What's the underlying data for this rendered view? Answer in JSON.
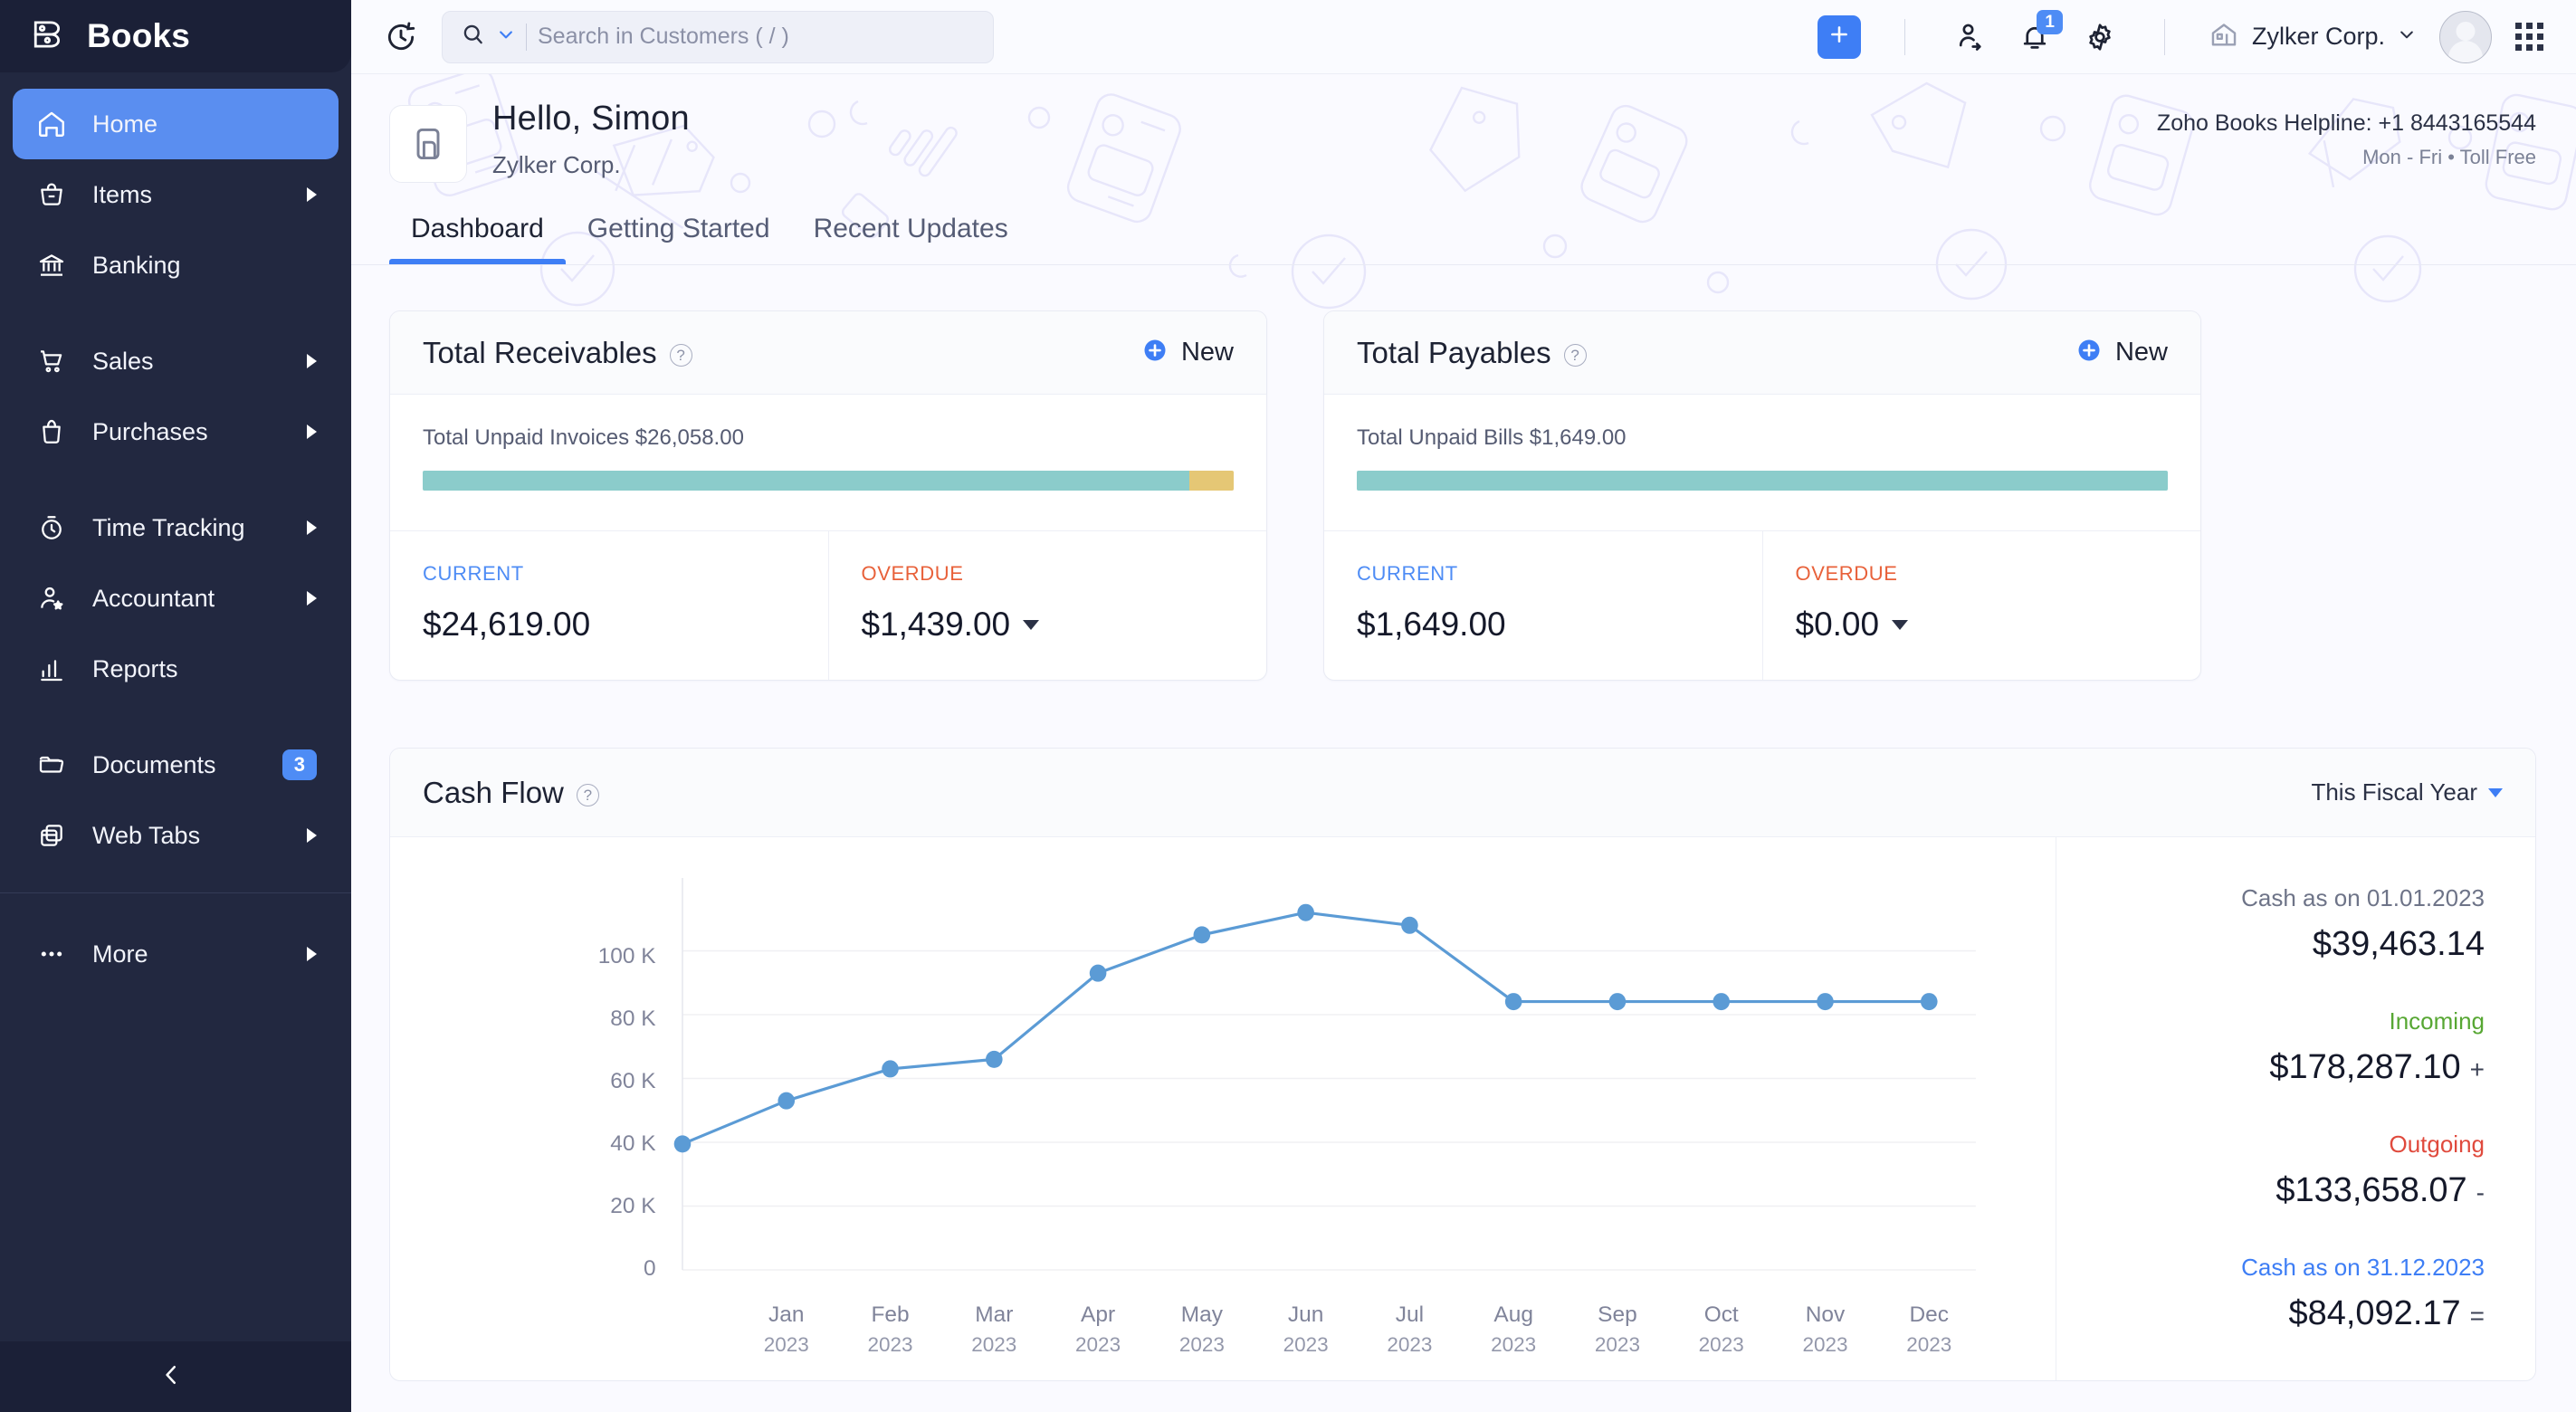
{
  "app": {
    "name": "Books"
  },
  "sidebar": {
    "items": [
      {
        "label": "Home",
        "icon": "home-icon",
        "active": true,
        "arrow": false,
        "badge": ""
      },
      {
        "label": "Items",
        "icon": "basket-icon",
        "active": false,
        "arrow": true,
        "badge": ""
      },
      {
        "label": "Banking",
        "icon": "bank-icon",
        "active": false,
        "arrow": false,
        "badge": ""
      },
      {
        "label": "Sales",
        "icon": "cart-icon",
        "active": false,
        "arrow": true,
        "badge": ""
      },
      {
        "label": "Purchases",
        "icon": "bag-icon",
        "active": false,
        "arrow": true,
        "badge": ""
      },
      {
        "label": "Time Tracking",
        "icon": "stopwatch-icon",
        "active": false,
        "arrow": true,
        "badge": ""
      },
      {
        "label": "Accountant",
        "icon": "user-star-icon",
        "active": false,
        "arrow": true,
        "badge": ""
      },
      {
        "label": "Reports",
        "icon": "bar-chart-icon",
        "active": false,
        "arrow": false,
        "badge": ""
      },
      {
        "label": "Documents",
        "icon": "folder-icon",
        "active": false,
        "arrow": false,
        "badge": "3"
      },
      {
        "label": "Web Tabs",
        "icon": "windows-icon",
        "active": false,
        "arrow": true,
        "badge": ""
      }
    ],
    "more": {
      "label": "More",
      "icon": "ellipsis-icon",
      "arrow": true
    },
    "collapse_icon": "chevron-left-icon"
  },
  "topbar": {
    "clock_icon": "history-clock-icon",
    "search": {
      "icon": "search-icon",
      "chevron": "chevron-down-icon",
      "placeholder": "Search in Customers ( / )",
      "value": ""
    },
    "plus_icon": "plus-icon",
    "contacts_icon": "contacts-icon",
    "bell_icon": "bell-icon",
    "bell_count": "1",
    "gear_icon": "gear-icon",
    "org_icon": "organization-home-icon",
    "org_name": "Zylker Corp.",
    "org_chevron": "chevron-down-icon",
    "avatar": "avatar",
    "apps_icon": "apps-grid-icon"
  },
  "header": {
    "tile_icon": "books-document-icon",
    "greeting": "Hello, Simon",
    "org": "Zylker Corp.",
    "helpline": "Zoho Books Helpline: +1 8443165544",
    "helpline_sub": "Mon - Fri • Toll Free"
  },
  "tabs": [
    {
      "label": "Dashboard",
      "active": true
    },
    {
      "label": "Getting Started",
      "active": false
    },
    {
      "label": "Recent Updates",
      "active": false
    }
  ],
  "receivables": {
    "title": "Total Receivables",
    "help_icon": "help-icon",
    "new_label": "New",
    "new_icon": "plus-circle-icon",
    "unpaid_label": "Total Unpaid Invoices $26,058.00",
    "bar": {
      "current_pct": 94.5,
      "overdue_pct": 5.5,
      "current_color": "#8bcccb",
      "overdue_color": "#e5c775"
    },
    "current_label": "CURRENT",
    "current_amount": "$24,619.00",
    "overdue_label": "OVERDUE",
    "overdue_amount": "$1,439.00"
  },
  "payables": {
    "title": "Total Payables",
    "help_icon": "help-icon",
    "new_label": "New",
    "new_icon": "plus-circle-icon",
    "unpaid_label": "Total Unpaid Bills $1,649.00",
    "bar": {
      "current_pct": 100,
      "overdue_pct": 0,
      "current_color": "#8bcccb",
      "overdue_color": "#e5c775"
    },
    "current_label": "CURRENT",
    "current_amount": "$1,649.00",
    "overdue_label": "OVERDUE",
    "overdue_amount": "$0.00"
  },
  "cashflow": {
    "title": "Cash Flow",
    "help_icon": "help-icon",
    "period": "This Fiscal Year",
    "period_chevron": "chevron-down-icon",
    "opening_label": "Cash as on 01.01.2023",
    "opening_value": "$39,463.14",
    "incoming_label": "Incoming",
    "incoming_value": "$178,287.10",
    "incoming_sign": "+",
    "outgoing_label": "Outgoing",
    "outgoing_value": "$133,658.07",
    "outgoing_sign": "-",
    "closing_label": "Cash as on 31.12.2023",
    "closing_value": "$84,092.17",
    "closing_sign": "="
  },
  "chart_data": {
    "type": "line",
    "title": "Cash Flow",
    "xlabel": "",
    "ylabel": "",
    "categories": [
      "Jan",
      "Feb",
      "Mar",
      "Apr",
      "May",
      "Jun",
      "Jul",
      "Aug",
      "Sep",
      "Oct",
      "Nov",
      "Dec"
    ],
    "category_years": [
      "2023",
      "2023",
      "2023",
      "2023",
      "2023",
      "2023",
      "2023",
      "2023",
      "2023",
      "2023",
      "2023",
      "2023"
    ],
    "x_tick_labels": [
      "Jan\n2023",
      "Feb\n2023",
      "Mar\n2023",
      "Apr\n2023",
      "May\n2023",
      "Jun\n2023",
      "Jul\n2023",
      "Aug\n2023",
      "Sep\n2023",
      "Oct\n2023",
      "Nov\n2023",
      "Dec\n2023"
    ],
    "y_tick_labels": [
      "0",
      "20 K",
      "40 K",
      "60 K",
      "80 K",
      "100 K"
    ],
    "y_ticks": [
      0,
      20000,
      40000,
      60000,
      80000,
      100000
    ],
    "ylim": [
      0,
      120000
    ],
    "grid": true,
    "legend": false,
    "line_color": "#5b9bd5",
    "point_color": "#5b9bd5",
    "series": [
      {
        "name": "Cash Flow",
        "values": [
          39463,
          53000,
          63000,
          66000,
          93000,
          105000,
          112000,
          108000,
          84092,
          84092,
          84092,
          84092,
          84092
        ]
      }
    ],
    "origin_point": {
      "label": "",
      "value": 39463
    },
    "points": [
      {
        "x": "start",
        "y": 39463
      },
      {
        "x": "Jan",
        "y": 53000
      },
      {
        "x": "Feb",
        "y": 63000
      },
      {
        "x": "Mar",
        "y": 66000
      },
      {
        "x": "Apr",
        "y": 93000
      },
      {
        "x": "May",
        "y": 105000
      },
      {
        "x": "Jun",
        "y": 112000
      },
      {
        "x": "Jul",
        "y": 108000
      },
      {
        "x": "Aug",
        "y": 84092
      },
      {
        "x": "Sep",
        "y": 84092
      },
      {
        "x": "Oct",
        "y": 84092
      },
      {
        "x": "Nov",
        "y": 84092
      },
      {
        "x": "Dec",
        "y": 84092
      }
    ]
  }
}
